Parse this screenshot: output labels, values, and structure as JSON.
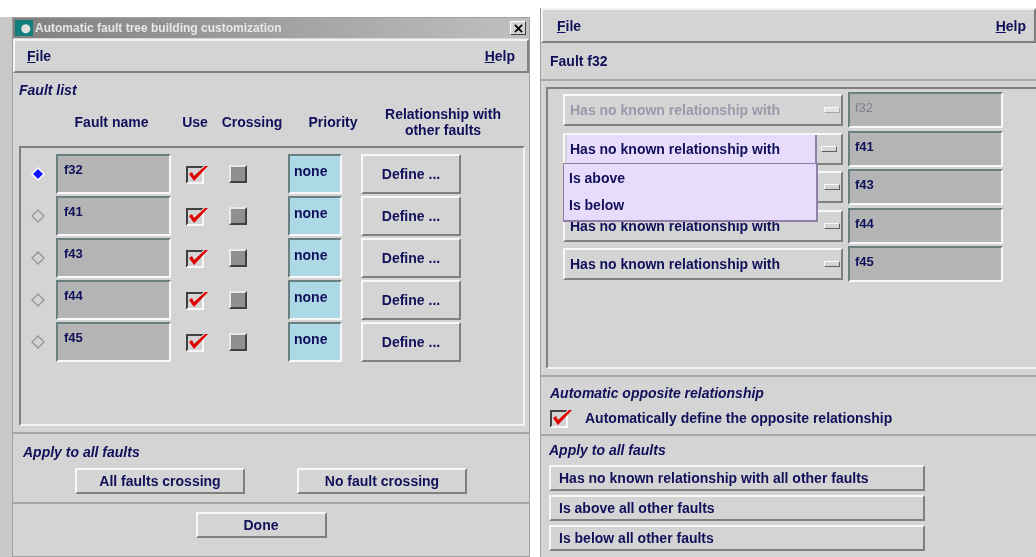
{
  "dialog": {
    "title": "Automatic fault tree building customization",
    "menu": [
      "File",
      "Help"
    ],
    "fault_list": {
      "title": "Fault list",
      "columns": [
        "Fault name",
        "Use",
        "Crossing",
        "Priority",
        "Relationship with other faults"
      ],
      "rows": [
        {
          "selected": true,
          "name": "f32",
          "use": true,
          "crossing": false,
          "priority": "none",
          "action": "Define ..."
        },
        {
          "selected": false,
          "name": "f41",
          "use": true,
          "crossing": false,
          "priority": "none",
          "action": "Define ..."
        },
        {
          "selected": false,
          "name": "f43",
          "use": true,
          "crossing": false,
          "priority": "none",
          "action": "Define ..."
        },
        {
          "selected": false,
          "name": "f44",
          "use": true,
          "crossing": false,
          "priority": "none",
          "action": "Define ..."
        },
        {
          "selected": false,
          "name": "f45",
          "use": true,
          "crossing": false,
          "priority": "none",
          "action": "Define ..."
        }
      ]
    },
    "apply": {
      "title": "Apply to all faults",
      "buttons": [
        "All faults crossing",
        "No fault crossing"
      ]
    },
    "done": "Done"
  },
  "relationship_window": {
    "menu": [
      "File",
      "Help"
    ],
    "fault_title": "Fault f32",
    "relations": [
      {
        "relationship": "Has no known relationship with",
        "disabled": true,
        "expanded": false,
        "fault": "f32"
      },
      {
        "relationship": "Has no known relationship with",
        "disabled": false,
        "expanded": true,
        "fault": "f41"
      },
      {
        "disabled": false,
        "expanded": false,
        "fault": "f43"
      },
      {
        "relationship": "Has no known relationship with",
        "disabled": false,
        "expanded": false,
        "fault": "f44"
      },
      {
        "relationship": "Has no known relationship with",
        "disabled": false,
        "expanded": false,
        "fault": "f45"
      }
    ],
    "dropdown_options": [
      "Is above",
      "Is below"
    ],
    "opposite": {
      "title": "Automatic opposite relationship",
      "label": "Automatically define the opposite relationship",
      "checked": true
    },
    "apply": {
      "title": "Apply to all faults",
      "buttons": [
        "Has no known relationship with all other faults",
        "Is above all other faults",
        "Is below all other faults"
      ]
    }
  }
}
